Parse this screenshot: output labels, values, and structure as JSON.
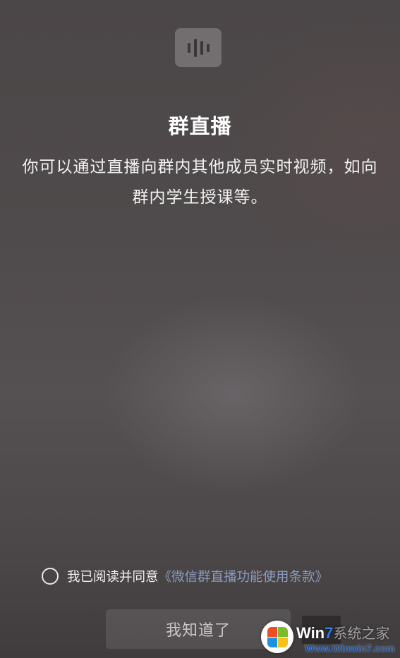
{
  "header": {
    "icon": "voice-waveform-icon",
    "title": "群直播",
    "description": "你可以通过直播向群内其他成员实时视频，如向群内学生授课等。"
  },
  "agreement": {
    "checked": false,
    "prefix": "我已阅读并同意",
    "link": "《微信群直播功能使用条款》"
  },
  "actions": {
    "confirm_label": "我知道了"
  },
  "watermark": {
    "brand_win": "Win",
    "brand_seven": "7",
    "brand_cn": "系统之家",
    "url": "Www.Winwin7.com"
  },
  "colors": {
    "link": "#8b9bbf",
    "title": "#ffffff",
    "button_text": "#c9c6c7"
  }
}
